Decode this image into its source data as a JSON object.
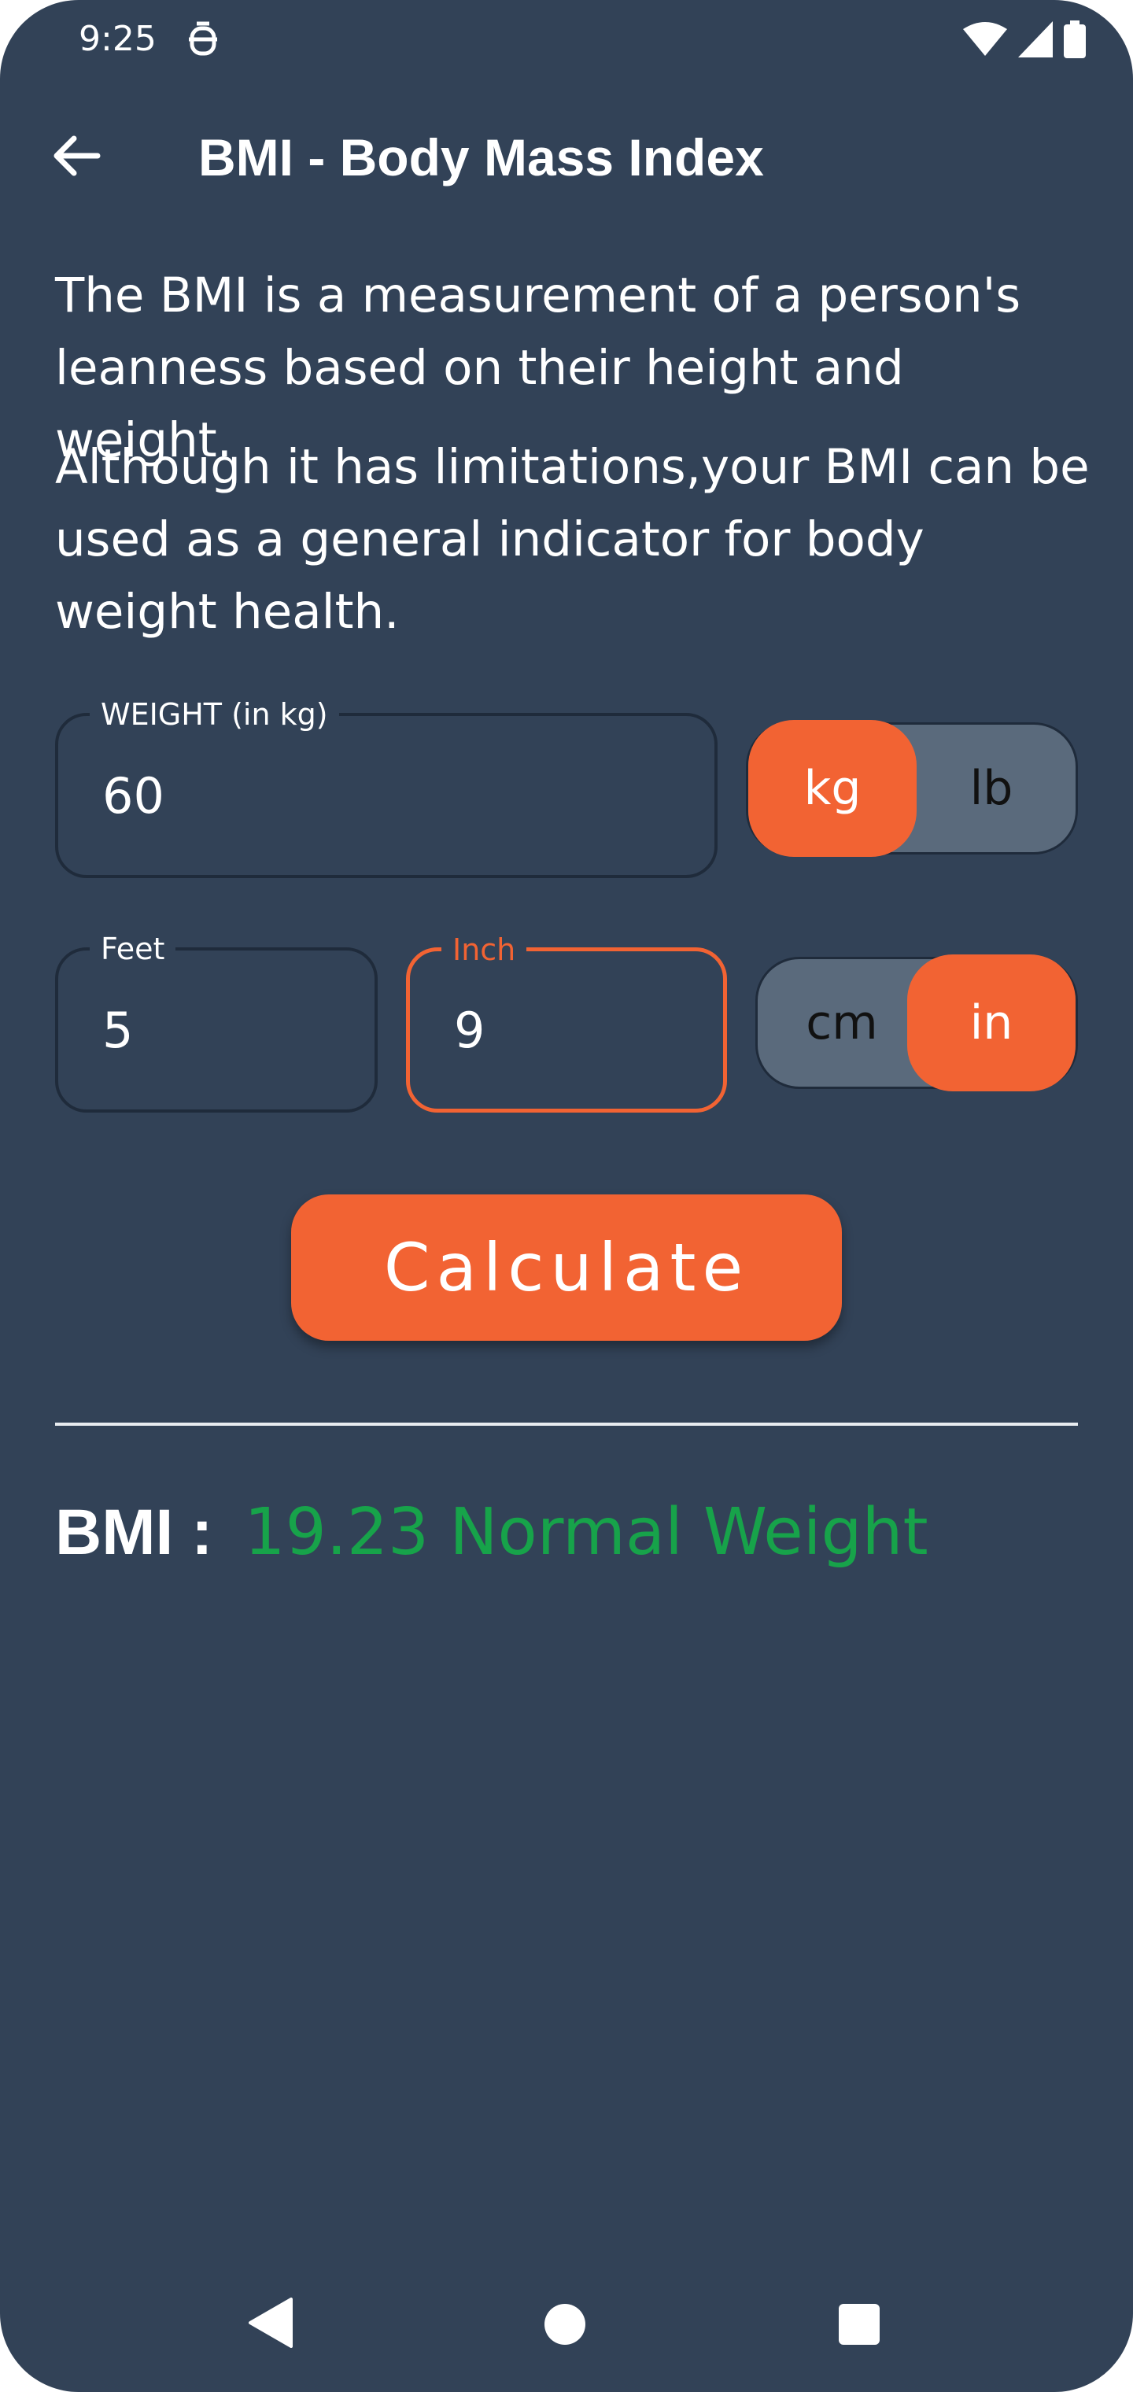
{
  "status_bar": {
    "time": "9:25",
    "icons": [
      "app-notification-icon",
      "wifi-icon",
      "cellular-signal-icon",
      "battery-icon"
    ]
  },
  "toolbar": {
    "back_icon": "arrow-left-icon",
    "title": "BMI - Body Mass Index"
  },
  "description": {
    "paragraph_1": "The BMI is a measurement of a person's leanness based on their height and weight.",
    "paragraph_2": "Although it has limitations,your BMI can be used as a general indicator for body weight health."
  },
  "weight": {
    "label": "WEIGHT (in kg)",
    "value": "60",
    "unit_toggle": {
      "options": [
        "kg",
        "lb"
      ],
      "selected": "kg"
    }
  },
  "height": {
    "feet": {
      "label": "Feet",
      "value": "5"
    },
    "inch": {
      "label": "Inch",
      "value": "9",
      "focused": true
    },
    "unit_toggle": {
      "options": [
        "cm",
        "in"
      ],
      "selected": "in"
    }
  },
  "calculate_button": {
    "label": "Calculate"
  },
  "result": {
    "label": "BMI :",
    "value": "19.23 Normal Weight"
  },
  "colors": {
    "background": "#324257",
    "accent": "#f26333",
    "toggle_unselected": "#5a6a7c",
    "result_green": "#17a34a",
    "text": "#ffffff"
  },
  "nav_bar": {
    "icons": [
      "nav-back-icon",
      "nav-home-icon",
      "nav-recents-icon"
    ]
  }
}
